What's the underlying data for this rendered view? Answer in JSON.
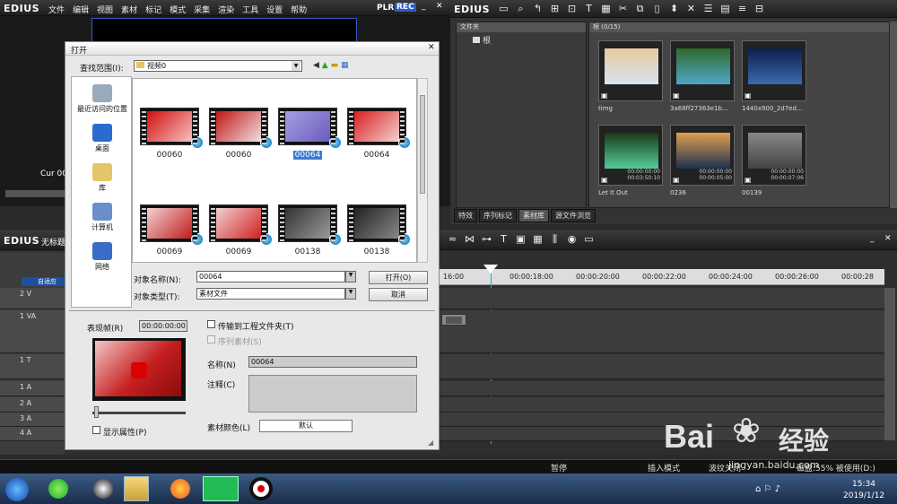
{
  "player": {
    "logo": "EDIUS",
    "menu": [
      "文件",
      "编辑",
      "视图",
      "素材",
      "标记",
      "模式",
      "采集",
      "渲染",
      "工具",
      "设置",
      "帮助"
    ],
    "plr": "PLR",
    "rec": "REC",
    "cur": "Cur 00"
  },
  "bin": {
    "logo": "EDIUS",
    "folder_header": "文件夹",
    "root": "根",
    "path": "根 (0/15)",
    "tabs": [
      "特效",
      "序列标记",
      "素材库",
      "源文件浏览"
    ],
    "clips": [
      {
        "name": "timg",
        "dur": "",
        "colors": [
          "#e8c9a0",
          "#d7e4ee"
        ]
      },
      {
        "name": "3a68ff27363e1b...",
        "dur": "",
        "colors": [
          "#2d6a2a",
          "#4fa6c8"
        ]
      },
      {
        "name": "1440x900_2d7ed...",
        "dur": "",
        "colors": [
          "#0e1e4c",
          "#3b6ab0"
        ]
      },
      {
        "name": "Let It Out",
        "dur": "00:00:00:00\n00:03:50:10",
        "colors": [
          "#1a3a1a",
          "#5c9"
        ]
      },
      {
        "name": "0236",
        "dur": "00:00:00:00\n00:00:05:00",
        "colors": [
          "#e0a050",
          "#1d3050"
        ]
      },
      {
        "name": "00139",
        "dur": "00:00:00:00\n00:00:07:06",
        "colors": [
          "#888",
          "#444"
        ]
      }
    ]
  },
  "timeline": {
    "logo": "EDIUS",
    "title": "无标题",
    "times": [
      "16:00",
      "00:00:18:00",
      "00:00:20:00",
      "00:00:22:00",
      "00:00:24:00",
      "00:00:26:00",
      "00:00:28"
    ],
    "tracks": [
      "2 V",
      "1 VA",
      "1 T",
      "1 A",
      "2 A",
      "3 A",
      "4 A"
    ],
    "subheader": "自适应"
  },
  "dialog": {
    "title": "打开",
    "lookin_label": "查找范围(I):",
    "lookin_value": "视频0",
    "nav": [
      "最近访问的位置",
      "桌面",
      "库",
      "计算机",
      "网络"
    ],
    "files": [
      {
        "name": "00060"
      },
      {
        "name": "00060"
      },
      {
        "name": "00064",
        "selected": true
      },
      {
        "name": "00064"
      },
      {
        "name": "00069"
      },
      {
        "name": "00069"
      },
      {
        "name": "00138"
      },
      {
        "name": "00138"
      }
    ],
    "filename_label": "对象名称(N):",
    "filename_value": "00064",
    "filetype_label": "对象类型(T):",
    "filetype_value": "素材文件",
    "open_btn": "打开(O)",
    "cancel_btn": "取消",
    "position_label": "表现帧(R)",
    "position_value": "00:00:00:00",
    "transfer_label": "传输到工程文件夹(T)",
    "seq_label": "序列素材(S)",
    "name_label": "名称(N)",
    "name_value": "00064",
    "comment_label": "注释(C)",
    "color_label": "素材颜色(L)",
    "color_value": "默认",
    "show_props": "显示属性(P)"
  },
  "status": {
    "pause": "暂停",
    "insert": "插入模式",
    "ripple": "波纹关闭",
    "disk": "磁盘:55% 被使用(D:)"
  },
  "taskbar": {
    "time": "15:34",
    "date": "2019/1/12"
  },
  "watermark": {
    "brand": "Bai",
    "brand2": "经验",
    "url": "jingyan.baidu.com"
  }
}
